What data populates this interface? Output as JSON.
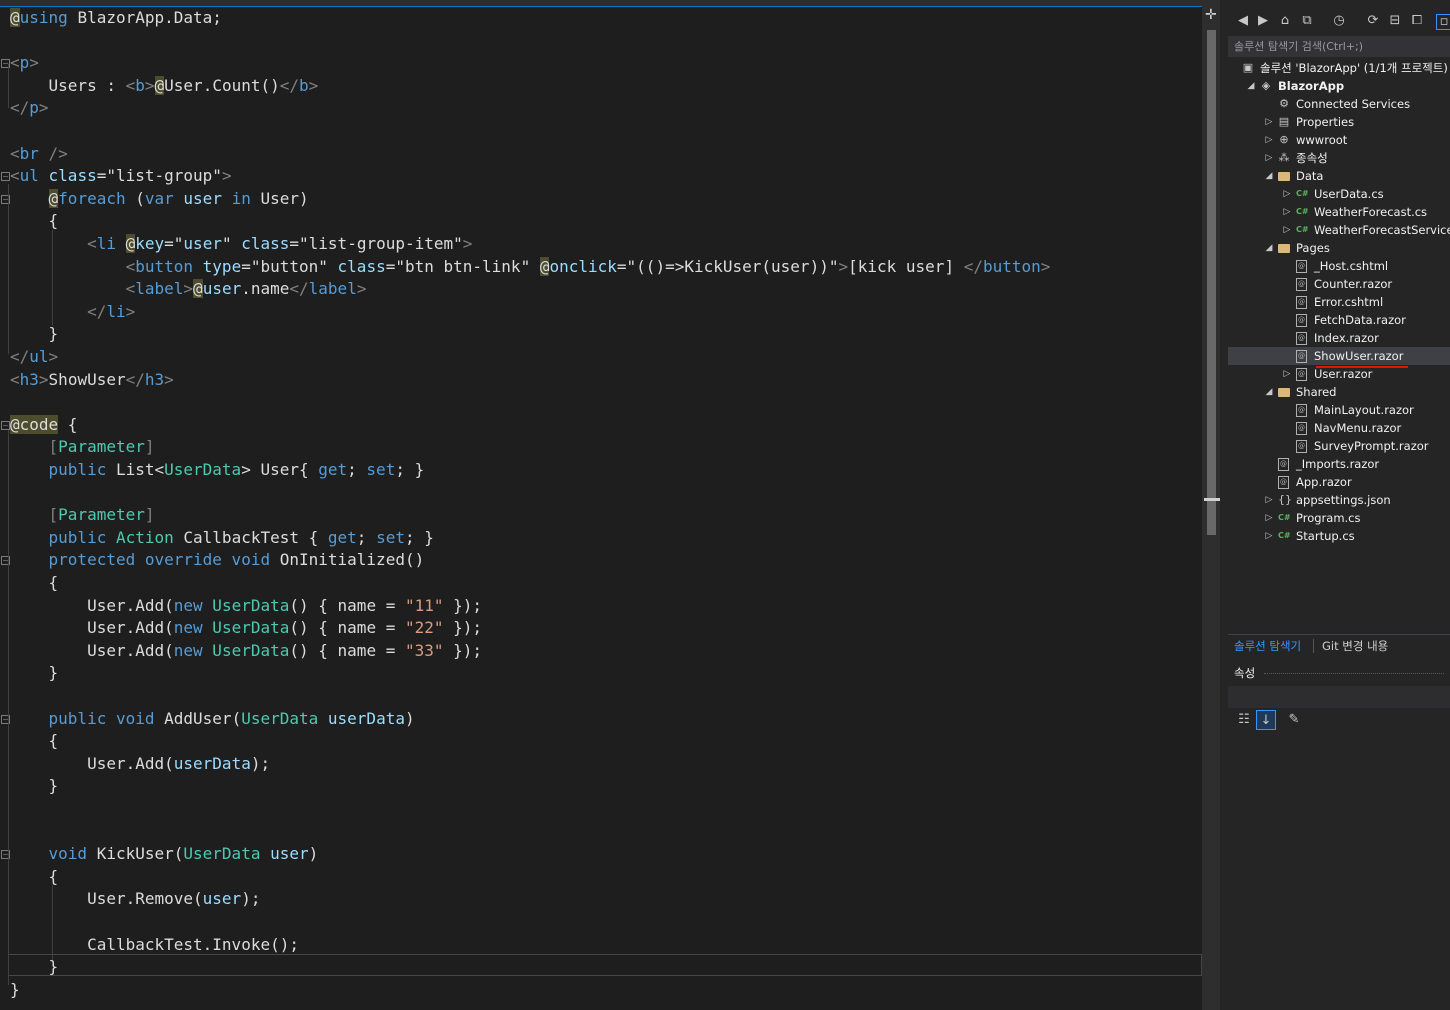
{
  "editor": {
    "lines": [
      [
        {
          "c": "at",
          "t": "@"
        },
        {
          "c": "kw",
          "t": "using"
        },
        {
          "c": "id",
          "t": " BlazorApp.Data;"
        }
      ],
      [],
      [
        {
          "c": "t",
          "t": "<"
        },
        {
          "c": "tn",
          "t": "p"
        },
        {
          "c": "t",
          "t": ">"
        }
      ],
      [
        {
          "c": "id",
          "t": "    Users : "
        },
        {
          "c": "t",
          "t": "<"
        },
        {
          "c": "tn",
          "t": "b"
        },
        {
          "c": "t",
          "t": ">"
        },
        {
          "c": "at",
          "t": "@"
        },
        {
          "c": "id",
          "t": "User.Count()"
        },
        {
          "c": "t",
          "t": "</"
        },
        {
          "c": "tn",
          "t": "b"
        },
        {
          "c": "t",
          "t": ">"
        }
      ],
      [
        {
          "c": "t",
          "t": "</"
        },
        {
          "c": "tn",
          "t": "p"
        },
        {
          "c": "t",
          "t": ">"
        }
      ],
      [],
      [
        {
          "c": "t",
          "t": "<"
        },
        {
          "c": "tn",
          "t": "br"
        },
        {
          "c": "t",
          "t": " />"
        }
      ],
      [
        {
          "c": "t",
          "t": "<"
        },
        {
          "c": "tn",
          "t": "ul"
        },
        {
          "c": "an",
          "t": " class"
        },
        {
          "c": "id",
          "t": "="
        },
        {
          "c": "id",
          "t": "\"list-group\""
        },
        {
          "c": "t",
          "t": ">"
        }
      ],
      [
        {
          "c": "id",
          "t": "    "
        },
        {
          "c": "at",
          "t": "@"
        },
        {
          "c": "kw",
          "t": "foreach"
        },
        {
          "c": "id",
          "t": " ("
        },
        {
          "c": "kw",
          "t": "var"
        },
        {
          "c": "an",
          "t": " user"
        },
        {
          "c": "kw",
          "t": " in"
        },
        {
          "c": "id",
          "t": " User)"
        }
      ],
      [
        {
          "c": "id",
          "t": "    {"
        }
      ],
      [
        {
          "c": "id",
          "t": "        "
        },
        {
          "c": "t",
          "t": "<"
        },
        {
          "c": "tn",
          "t": "li"
        },
        {
          "c": "id",
          "t": " "
        },
        {
          "c": "at",
          "t": "@"
        },
        {
          "c": "an",
          "t": "key"
        },
        {
          "c": "id",
          "t": "=\""
        },
        {
          "c": "an",
          "t": "user"
        },
        {
          "c": "id",
          "t": "\""
        },
        {
          "c": "an",
          "t": " class"
        },
        {
          "c": "id",
          "t": "=\"list-group-item\""
        },
        {
          "c": "t",
          "t": ">"
        }
      ],
      [
        {
          "c": "id",
          "t": "            "
        },
        {
          "c": "t",
          "t": "<"
        },
        {
          "c": "tn",
          "t": "button"
        },
        {
          "c": "an",
          "t": " type"
        },
        {
          "c": "id",
          "t": "=\"button\""
        },
        {
          "c": "an",
          "t": " class"
        },
        {
          "c": "id",
          "t": "=\"btn btn-link\" "
        },
        {
          "c": "at",
          "t": "@"
        },
        {
          "c": "an",
          "t": "onclick"
        },
        {
          "c": "id",
          "t": "=\"(()=>KickUser(user))\""
        },
        {
          "c": "t",
          "t": ">"
        },
        {
          "c": "id",
          "t": "[kick user] "
        },
        {
          "c": "t",
          "t": "</"
        },
        {
          "c": "tn",
          "t": "button"
        },
        {
          "c": "t",
          "t": ">"
        }
      ],
      [
        {
          "c": "id",
          "t": "            "
        },
        {
          "c": "t",
          "t": "<"
        },
        {
          "c": "tn",
          "t": "label"
        },
        {
          "c": "t",
          "t": ">"
        },
        {
          "c": "at",
          "t": "@"
        },
        {
          "c": "an",
          "t": "user"
        },
        {
          "c": "id",
          "t": ".name"
        },
        {
          "c": "t",
          "t": "</"
        },
        {
          "c": "tn",
          "t": "label"
        },
        {
          "c": "t",
          "t": ">"
        }
      ],
      [
        {
          "c": "id",
          "t": "        "
        },
        {
          "c": "t",
          "t": "</"
        },
        {
          "c": "tn",
          "t": "li"
        },
        {
          "c": "t",
          "t": ">"
        }
      ],
      [
        {
          "c": "id",
          "t": "    }"
        }
      ],
      [
        {
          "c": "t",
          "t": "</"
        },
        {
          "c": "tn",
          "t": "ul"
        },
        {
          "c": "t",
          "t": ">"
        }
      ],
      [
        {
          "c": "t",
          "t": "<"
        },
        {
          "c": "tn",
          "t": "h3"
        },
        {
          "c": "t",
          "t": ">"
        },
        {
          "c": "id",
          "t": "ShowUser"
        },
        {
          "c": "t",
          "t": "</"
        },
        {
          "c": "tn",
          "t": "h3"
        },
        {
          "c": "t",
          "t": ">"
        }
      ],
      [],
      [
        {
          "c": "at",
          "t": "@code"
        },
        {
          "c": "id",
          "t": " {"
        }
      ],
      [
        {
          "c": "id",
          "t": "    "
        },
        {
          "c": "t",
          "t": "["
        },
        {
          "c": "ty",
          "t": "Parameter"
        },
        {
          "c": "t",
          "t": "]"
        }
      ],
      [
        {
          "c": "id",
          "t": "    "
        },
        {
          "c": "kw",
          "t": "public"
        },
        {
          "c": "id",
          "t": " List<"
        },
        {
          "c": "ty",
          "t": "UserData"
        },
        {
          "c": "id",
          "t": "> User{ "
        },
        {
          "c": "kw",
          "t": "get"
        },
        {
          "c": "id",
          "t": "; "
        },
        {
          "c": "kw",
          "t": "set"
        },
        {
          "c": "id",
          "t": "; }"
        }
      ],
      [],
      [
        {
          "c": "id",
          "t": "    "
        },
        {
          "c": "t",
          "t": "["
        },
        {
          "c": "ty",
          "t": "Parameter"
        },
        {
          "c": "t",
          "t": "]"
        }
      ],
      [
        {
          "c": "id",
          "t": "    "
        },
        {
          "c": "kw",
          "t": "public"
        },
        {
          "c": "ty",
          "t": " Action"
        },
        {
          "c": "id",
          "t": " CallbackTest { "
        },
        {
          "c": "kw",
          "t": "get"
        },
        {
          "c": "id",
          "t": "; "
        },
        {
          "c": "kw",
          "t": "set"
        },
        {
          "c": "id",
          "t": "; }"
        }
      ],
      [
        {
          "c": "id",
          "t": "    "
        },
        {
          "c": "kw",
          "t": "protected override void"
        },
        {
          "c": "id",
          "t": " OnInitialized()"
        }
      ],
      [
        {
          "c": "id",
          "t": "    {"
        }
      ],
      [
        {
          "c": "id",
          "t": "        User.Add("
        },
        {
          "c": "kw",
          "t": "new"
        },
        {
          "c": "ty",
          "t": " UserData"
        },
        {
          "c": "id",
          "t": "() { name = "
        },
        {
          "c": "st",
          "t": "\"11\""
        },
        {
          "c": "id",
          "t": " });"
        }
      ],
      [
        {
          "c": "id",
          "t": "        User.Add("
        },
        {
          "c": "kw",
          "t": "new"
        },
        {
          "c": "ty",
          "t": " UserData"
        },
        {
          "c": "id",
          "t": "() { name = "
        },
        {
          "c": "st",
          "t": "\"22\""
        },
        {
          "c": "id",
          "t": " });"
        }
      ],
      [
        {
          "c": "id",
          "t": "        User.Add("
        },
        {
          "c": "kw",
          "t": "new"
        },
        {
          "c": "ty",
          "t": " UserData"
        },
        {
          "c": "id",
          "t": "() { name = "
        },
        {
          "c": "st",
          "t": "\"33\""
        },
        {
          "c": "id",
          "t": " });"
        }
      ],
      [
        {
          "c": "id",
          "t": "    }"
        }
      ],
      [],
      [
        {
          "c": "id",
          "t": "    "
        },
        {
          "c": "kw",
          "t": "public void"
        },
        {
          "c": "id",
          "t": " AddUser("
        },
        {
          "c": "ty",
          "t": "UserData"
        },
        {
          "c": "an",
          "t": " userData"
        },
        {
          "c": "id",
          "t": ")"
        }
      ],
      [
        {
          "c": "id",
          "t": "    {"
        }
      ],
      [
        {
          "c": "id",
          "t": "        User.Add("
        },
        {
          "c": "an",
          "t": "userData"
        },
        {
          "c": "id",
          "t": ");"
        }
      ],
      [
        {
          "c": "id",
          "t": "    }"
        }
      ],
      [],
      [],
      [
        {
          "c": "id",
          "t": "    "
        },
        {
          "c": "kw",
          "t": "void"
        },
        {
          "c": "id",
          "t": " KickUser("
        },
        {
          "c": "ty",
          "t": "UserData"
        },
        {
          "c": "an",
          "t": " user"
        },
        {
          "c": "id",
          "t": ")"
        }
      ],
      [
        {
          "c": "id",
          "t": "    {"
        }
      ],
      [
        {
          "c": "id",
          "t": "        User.Remove("
        },
        {
          "c": "an",
          "t": "user"
        },
        {
          "c": "id",
          "t": ");"
        }
      ],
      [],
      [
        {
          "c": "id",
          "t": "        CallbackTest.Invoke();"
        }
      ],
      [
        {
          "c": "id",
          "t": "    }"
        }
      ],
      [
        {
          "c": "id",
          "t": "}"
        }
      ]
    ]
  },
  "explorer": {
    "search_placeholder": "솔루션 탐색기 검색(Ctrl+;)",
    "tree": [
      {
        "label": "솔루션 'BlazorApp' (1/1개 프로젝트)",
        "icon": "solution-icon",
        "glyph": "▣",
        "depth": 0,
        "expander": "",
        "bold": false
      },
      {
        "label": "BlazorApp",
        "icon": "project-icon",
        "glyph": "◈",
        "depth": 1,
        "expander": "◢",
        "bold": true
      },
      {
        "label": "Connected Services",
        "icon": "connected-services-icon",
        "glyph": "⚙",
        "depth": 2,
        "expander": "",
        "bold": false
      },
      {
        "label": "Properties",
        "icon": "properties-icon",
        "glyph": "▤",
        "depth": 2,
        "expander": "▷",
        "bold": false
      },
      {
        "label": "wwwroot",
        "icon": "globe-icon",
        "glyph": "⊕",
        "depth": 2,
        "expander": "▷",
        "bold": false
      },
      {
        "label": "종속성",
        "icon": "dependencies-icon",
        "glyph": "⁂",
        "depth": 2,
        "expander": "▷",
        "bold": false
      },
      {
        "label": "Data",
        "icon": "folder-icon",
        "glyph": "",
        "depth": 2,
        "expander": "◢",
        "bold": false
      },
      {
        "label": "UserData.cs",
        "icon": "csharp-file-icon",
        "glyph": "C#",
        "depth": 3,
        "expander": "▷",
        "bold": false
      },
      {
        "label": "WeatherForecast.cs",
        "icon": "csharp-file-icon",
        "glyph": "C#",
        "depth": 3,
        "expander": "▷",
        "bold": false
      },
      {
        "label": "WeatherForecastService.cs",
        "icon": "csharp-file-icon",
        "glyph": "C#",
        "depth": 3,
        "expander": "▷",
        "bold": false
      },
      {
        "label": "Pages",
        "icon": "folder-icon",
        "glyph": "",
        "depth": 2,
        "expander": "◢",
        "bold": false
      },
      {
        "label": "_Host.cshtml",
        "icon": "razor-file-icon",
        "glyph": "@",
        "depth": 3,
        "expander": "",
        "bold": false
      },
      {
        "label": "Counter.razor",
        "icon": "razor-file-icon",
        "glyph": "@",
        "depth": 3,
        "expander": "",
        "bold": false
      },
      {
        "label": "Error.cshtml",
        "icon": "razor-file-icon",
        "glyph": "@",
        "depth": 3,
        "expander": "",
        "bold": false
      },
      {
        "label": "FetchData.razor",
        "icon": "razor-file-icon",
        "glyph": "@",
        "depth": 3,
        "expander": "",
        "bold": false
      },
      {
        "label": "Index.razor",
        "icon": "razor-file-icon",
        "glyph": "@",
        "depth": 3,
        "expander": "",
        "bold": false
      },
      {
        "label": "ShowUser.razor",
        "icon": "razor-file-icon",
        "glyph": "@",
        "depth": 3,
        "expander": "",
        "bold": false,
        "selected": true
      },
      {
        "label": "User.razor",
        "icon": "razor-file-icon",
        "glyph": "@",
        "depth": 3,
        "expander": "▷",
        "bold": false
      },
      {
        "label": "Shared",
        "icon": "folder-icon",
        "glyph": "",
        "depth": 2,
        "expander": "◢",
        "bold": false
      },
      {
        "label": "MainLayout.razor",
        "icon": "razor-file-icon",
        "glyph": "@",
        "depth": 3,
        "expander": "",
        "bold": false
      },
      {
        "label": "NavMenu.razor",
        "icon": "razor-file-icon",
        "glyph": "@",
        "depth": 3,
        "expander": "",
        "bold": false
      },
      {
        "label": "SurveyPrompt.razor",
        "icon": "razor-file-icon",
        "glyph": "@",
        "depth": 3,
        "expander": "",
        "bold": false
      },
      {
        "label": "_Imports.razor",
        "icon": "razor-file-icon",
        "glyph": "@",
        "depth": 2,
        "expander": "",
        "bold": false
      },
      {
        "label": "App.razor",
        "icon": "razor-file-icon",
        "glyph": "@",
        "depth": 2,
        "expander": "",
        "bold": false
      },
      {
        "label": "appsettings.json",
        "icon": "json-file-icon",
        "glyph": "{}",
        "depth": 2,
        "expander": "▷",
        "bold": false
      },
      {
        "label": "Program.cs",
        "icon": "csharp-file-icon",
        "glyph": "C#",
        "depth": 2,
        "expander": "▷",
        "bold": false
      },
      {
        "label": "Startup.cs",
        "icon": "csharp-file-icon",
        "glyph": "C#",
        "depth": 2,
        "expander": "▷",
        "bold": false
      }
    ],
    "tabs": {
      "solution_explorer": "솔루션 탐색기",
      "git_changes": "Git 변경 내용"
    }
  },
  "properties": {
    "title": "속성"
  },
  "colors": {
    "accent": "#007acc",
    "selection_underline": "#e51400",
    "background": "#1e1e1e"
  }
}
